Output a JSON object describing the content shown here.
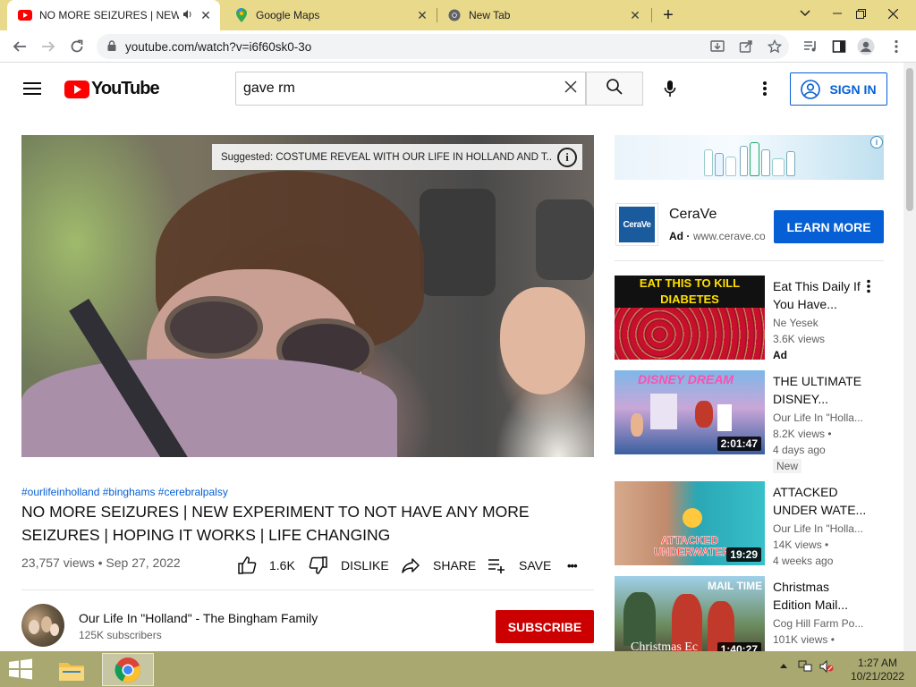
{
  "browser": {
    "tabs": [
      {
        "title": "NO MORE SEIZURES | NEW E",
        "favicon": "youtube-icon",
        "active": true,
        "audio": true
      },
      {
        "title": "Google Maps",
        "favicon": "maps-pin-icon",
        "active": false
      },
      {
        "title": "New Tab",
        "favicon": "chrome-icon",
        "active": false
      }
    ],
    "new_tab_label": "+",
    "url": "youtube.com/watch?v=i6f60sk0-3o"
  },
  "yt": {
    "logo_text": "YouTube",
    "search_value": "gave rm",
    "signin_label": "SIGN IN"
  },
  "video": {
    "suggested_text": "Suggested: COSTUME REVEAL WITH OUR LIFE IN HOLLAND AND T...",
    "hashtags": "#ourlifeinholland #binghams #cerebralpalsy",
    "title": "NO MORE SEIZURES | NEW EXPERIMENT TO NOT HAVE ANY MORE SEIZURES | HOPING IT WORKS | LIFE CHANGING",
    "views_date": "23,757 views • Sep 27, 2022",
    "like_count": "1.6K",
    "dislike_label": "DISLIKE",
    "share_label": "SHARE",
    "save_label": "SAVE",
    "more_label": "•••"
  },
  "channel": {
    "name": "Our Life In \"Holland\" - The Bingham Family",
    "subscribers": "125K subscribers",
    "subscribe_label": "SUBSCRIBE"
  },
  "ad": {
    "info_glyph": "i",
    "logo_text": "CeraVe",
    "name": "CeraVe",
    "tag": "Ad",
    "separator": "·",
    "url": "www.cerave.com",
    "cta": "LEARN MORE"
  },
  "recommended": [
    {
      "thumb_text": "EAT THIS TO KILL DIABETES",
      "title": "Eat This Daily If You Have...",
      "channel": "Ne Yesek",
      "views": "3.6K views",
      "ad_label": "Ad"
    },
    {
      "thumb_text": "DISNEY DREAM",
      "title": "THE ULTIMATE DISNEY...",
      "channel": "Our Life In \"Holla...",
      "views": "8.2K views •",
      "age": "4 days ago",
      "badge": "New",
      "duration": "2:01:47"
    },
    {
      "thumb_text": "ATTACKED UNDERWATER",
      "title": "ATTACKED UNDER WATE...",
      "channel": "Our Life In \"Holla...",
      "views": "14K views •",
      "age": "4 weeks ago",
      "duration": "19:29"
    },
    {
      "thumb_text": "MAIL TIME",
      "thumb_text2": "Christmas Ec",
      "title": "Christmas Edition Mail...",
      "channel": "Cog Hill Farm Po...",
      "views": "101K views •",
      "duration": "1:40:27"
    }
  ],
  "taskbar": {
    "time": "1:27 AM",
    "date": "10/21/2022"
  },
  "colors": {
    "tabstrip": "#e9d98a",
    "yt_red": "#ff0000",
    "subscribe_red": "#cc0000",
    "link_blue": "#065fd4",
    "taskbar": "#a8a870"
  }
}
